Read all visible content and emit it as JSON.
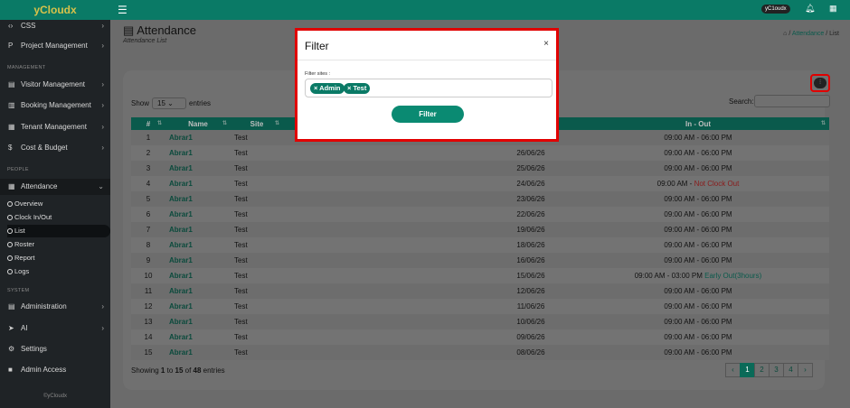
{
  "brand": "yCloudx",
  "topbar": {
    "user_chip": "yC1oudx",
    "bell_icon": "bell-icon",
    "apps_icon": "grid-icon"
  },
  "sidebar": {
    "items_top": [
      {
        "label": "CSS",
        "icon": "code-icon"
      },
      {
        "label": "Project Management",
        "icon": "project-icon"
      }
    ],
    "section_management": "MANAGEMENT",
    "items_mgmt": [
      {
        "label": "Visitor Management"
      },
      {
        "label": "Booking Management"
      },
      {
        "label": "Tenant Management"
      },
      {
        "label": "Cost & Budget"
      }
    ],
    "section_people": "PEOPLE",
    "attendance": "Attendance",
    "subitems": [
      "Overview",
      "Clock In/Out",
      "List",
      "Roster",
      "Report",
      "Logs"
    ],
    "section_system": "SYSTEM",
    "items_sys": [
      {
        "label": "Administration"
      },
      {
        "label": "AI"
      },
      {
        "label": "Settings"
      },
      {
        "label": "Admin Access"
      }
    ],
    "footer": "©yCloudx"
  },
  "page": {
    "title": "Attendance",
    "subtitle": "Attendance List",
    "breadcrumb": {
      "home": "⌂",
      "link": "Attendance",
      "current": "List"
    }
  },
  "table_controls": {
    "show": "Show",
    "entries": "entries",
    "page_size": "15",
    "search_label": "Search:"
  },
  "table": {
    "headers": [
      "#",
      "Name",
      "Site",
      "",
      "",
      "In - Out"
    ],
    "rows": [
      {
        "n": "1",
        "name": "Abrar1",
        "site": "Test",
        "date": "",
        "inout": "09:00 AM - 06:00 PM",
        "note": ""
      },
      {
        "n": "2",
        "name": "Abrar1",
        "site": "Test",
        "date": "26/06/26",
        "inout": "09:00 AM - 06:00 PM",
        "note": ""
      },
      {
        "n": "3",
        "name": "Abrar1",
        "site": "Test",
        "date": "25/06/26",
        "inout": "09:00 AM - 06:00 PM",
        "note": ""
      },
      {
        "n": "4",
        "name": "Abrar1",
        "site": "Test",
        "date": "24/06/26",
        "inout": "09:00 AM - ",
        "note": "Not Clock Out"
      },
      {
        "n": "5",
        "name": "Abrar1",
        "site": "Test",
        "date": "23/06/26",
        "inout": "09:00 AM - 06:00 PM",
        "note": ""
      },
      {
        "n": "6",
        "name": "Abrar1",
        "site": "Test",
        "date": "22/06/26",
        "inout": "09:00 AM - 06:00 PM",
        "note": ""
      },
      {
        "n": "7",
        "name": "Abrar1",
        "site": "Test",
        "date": "19/06/26",
        "inout": "09:00 AM - 06:00 PM",
        "note": ""
      },
      {
        "n": "8",
        "name": "Abrar1",
        "site": "Test",
        "date": "18/06/26",
        "inout": "09:00 AM - 06:00 PM",
        "note": ""
      },
      {
        "n": "9",
        "name": "Abrar1",
        "site": "Test",
        "date": "16/06/26",
        "inout": "09:00 AM - 06:00 PM",
        "note": ""
      },
      {
        "n": "10",
        "name": "Abrar1",
        "site": "Test",
        "date": "15/06/26",
        "inout": "09:00 AM - 03:00 PM ",
        "note": "Early Out(3hours)"
      },
      {
        "n": "11",
        "name": "Abrar1",
        "site": "Test",
        "date": "12/06/26",
        "inout": "09:00 AM - 06:00 PM",
        "note": ""
      },
      {
        "n": "12",
        "name": "Abrar1",
        "site": "Test",
        "date": "11/06/26",
        "inout": "09:00 AM - 06:00 PM",
        "note": ""
      },
      {
        "n": "13",
        "name": "Abrar1",
        "site": "Test",
        "date": "10/06/26",
        "inout": "09:00 AM - 06:00 PM",
        "note": ""
      },
      {
        "n": "14",
        "name": "Abrar1",
        "site": "Test",
        "date": "09/06/26",
        "inout": "09:00 AM - 06:00 PM",
        "note": ""
      },
      {
        "n": "15",
        "name": "Abrar1",
        "site": "Test",
        "date": "08/06/26",
        "inout": "09:00 AM - 06:00 PM",
        "note": ""
      }
    ],
    "showing_prefix": "Showing ",
    "showing_from": "1",
    "showing_mid1": " to ",
    "showing_to": "15",
    "showing_mid2": " of ",
    "showing_total": "48",
    "showing_suffix": " entries"
  },
  "pager": {
    "prev": "‹",
    "pages": [
      "1",
      "2",
      "3",
      "4"
    ],
    "next": "›"
  },
  "modal": {
    "title": "Filter",
    "close": "×",
    "label": "Filter sites :",
    "tags": [
      "× Admin",
      "× Test"
    ],
    "button": "Filter"
  },
  "colors": {
    "brand": "#0a7a66",
    "highlight": "#e10000"
  }
}
